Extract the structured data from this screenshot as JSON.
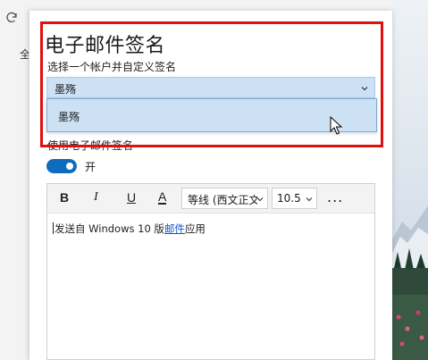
{
  "background": {
    "left_strip_label": "全",
    "refresh_icon": "refresh-icon"
  },
  "panel": {
    "title": "电子邮件签名",
    "subtitle": "选择一个帐户并自定义签名",
    "account_combo": {
      "value": "墨殇"
    },
    "dropdown_options": [
      "墨殇"
    ],
    "use_signature_label": "使用电子邮件签名",
    "toggle": {
      "state": "on",
      "label": "开"
    },
    "toolbar": {
      "bold": "B",
      "italic": "I",
      "underline": "U",
      "font_color": "A",
      "font_family": "等线 (西文正文)",
      "font_size": "10.5",
      "more": "..."
    },
    "signature_body": {
      "prefix": "发送自 Windows 10 版",
      "link": "邮件",
      "suffix": "应用"
    }
  },
  "colors": {
    "accent": "#0f6cbd",
    "selection": "#cde1f5",
    "highlight_border": "#e01010",
    "link": "#0b57d0"
  }
}
